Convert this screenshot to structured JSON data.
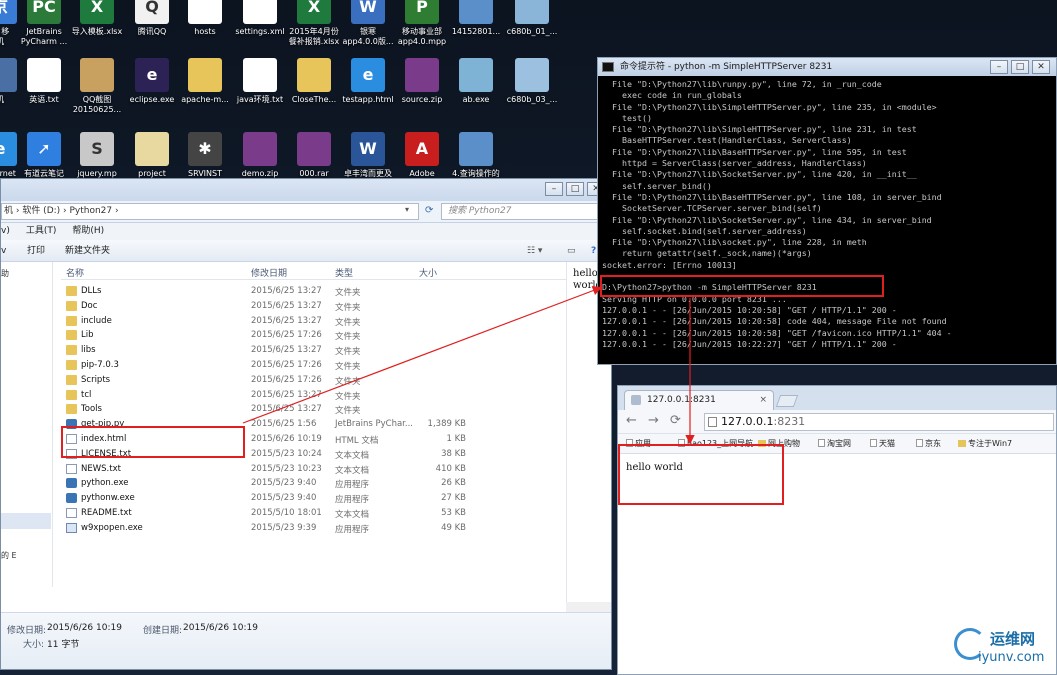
{
  "desktop": {
    "icons": [
      {
        "label": "京 移\n机",
        "icon": "app-icon",
        "color": "#3a7bd5",
        "glyph": "京"
      },
      {
        "label": "JetBrains\nPyCharm ...",
        "icon": "pycharm-icon",
        "color": "#2b7a3a",
        "glyph": "PC"
      },
      {
        "label": "导入模板.xlsx",
        "icon": "excel-icon",
        "color": "#1f7a3e",
        "glyph": "X"
      },
      {
        "label": "腾讯QQ",
        "icon": "qq-icon",
        "color": "#f1f1f1",
        "glyph": "Q"
      },
      {
        "label": "hosts",
        "icon": "file-icon",
        "color": "#ffffff",
        "glyph": ""
      },
      {
        "label": "settings.xml",
        "icon": "file-icon",
        "color": "#ffffff",
        "glyph": ""
      },
      {
        "label": "2015年4月份\n餐补报销.xlsx",
        "icon": "excel-icon",
        "color": "#1f7a3e",
        "glyph": "X"
      },
      {
        "label": "银寒\napp4.0.0版...",
        "icon": "document-icon",
        "color": "#3a6fbf",
        "glyph": "W"
      },
      {
        "label": "移动事业部\napp4.0.mpp",
        "icon": "project-icon",
        "color": "#2e7d32",
        "glyph": "P"
      },
      {
        "label": "14152801...",
        "icon": "image-icon",
        "color": "#5a8fc9",
        "glyph": ""
      },
      {
        "label": "c680b_01_...",
        "icon": "image-icon",
        "color": "#8ab4d8",
        "glyph": ""
      },
      {
        "label": "机",
        "icon": "app-icon",
        "color": "#4a6fa5",
        "glyph": ""
      },
      {
        "label": "英语.txt",
        "icon": "text-file-icon",
        "color": "#ffffff",
        "glyph": ""
      },
      {
        "label": "QQ截图\n20150625...",
        "icon": "image-icon",
        "color": "#c8a060",
        "glyph": ""
      },
      {
        "label": "eclipse.exe",
        "icon": "eclipse-icon",
        "color": "#2c2255",
        "glyph": "e"
      },
      {
        "label": "apache-m...",
        "icon": "folder-icon",
        "color": "#e8c55a",
        "glyph": ""
      },
      {
        "label": "java环境.txt",
        "icon": "text-file-icon",
        "color": "#ffffff",
        "glyph": ""
      },
      {
        "label": "CloseThe...",
        "icon": "folder-icon",
        "color": "#e8c55a",
        "glyph": ""
      },
      {
        "label": "testapp.html",
        "icon": "ie-icon",
        "color": "#2a8de0",
        "glyph": "e"
      },
      {
        "label": "source.zip",
        "icon": "zip-icon",
        "color": "#7a3b8a",
        "glyph": ""
      },
      {
        "label": "ab.exe",
        "icon": "exe-icon",
        "color": "#7fb3d6",
        "glyph": ""
      },
      {
        "label": "c680b_03_...",
        "icon": "image-icon",
        "color": "#9cc0e0",
        "glyph": ""
      },
      {
        "label": "Internet",
        "icon": "ie-icon",
        "color": "#2a8de0",
        "glyph": "e"
      },
      {
        "label": "有道云笔记",
        "icon": "youdao-icon",
        "color": "#2f7fe0",
        "glyph": "➚"
      },
      {
        "label": "jquery.mp",
        "icon": "script-icon",
        "color": "#c8c8c8",
        "glyph": "S"
      },
      {
        "label": "project",
        "icon": "document-icon",
        "color": "#e8d9a0",
        "glyph": ""
      },
      {
        "label": "SRVINST",
        "icon": "gear-icon",
        "color": "#444444",
        "glyph": "✱"
      },
      {
        "label": "demo.zip",
        "icon": "zip-icon",
        "color": "#7a3b8a",
        "glyph": ""
      },
      {
        "label": "000.rar",
        "icon": "zip-icon",
        "color": "#7a3b8a",
        "glyph": ""
      },
      {
        "label": "卓丰湾而更及",
        "icon": "word-icon",
        "color": "#2a5699",
        "glyph": "W"
      },
      {
        "label": "Adobe",
        "icon": "pdf-icon",
        "color": "#c81e1e",
        "glyph": "A"
      },
      {
        "label": "4.查询操作的",
        "icon": "window-icon",
        "color": "#5a8fc9",
        "glyph": ""
      }
    ]
  },
  "explorer": {
    "breadcrumb": "机 › 软件 (D:) › Python27 ›",
    "search_placeholder": "搜索 Python27",
    "menu": {
      "tools": "工具(T)",
      "help": "帮助(H)",
      "partial": "v)"
    },
    "toolbar": {
      "print": "打印",
      "new_folder": "新建文件夹",
      "partial": "v"
    },
    "columns": {
      "name": "名称",
      "date": "修改日期",
      "type": "类型",
      "size": "大小"
    },
    "files": [
      {
        "name": "DLLs",
        "date": "2015/6/25 13:27",
        "type": "文件夹",
        "size": "",
        "kind": "folder"
      },
      {
        "name": "Doc",
        "date": "2015/6/25 13:27",
        "type": "文件夹",
        "size": "",
        "kind": "folder"
      },
      {
        "name": "include",
        "date": "2015/6/25 13:27",
        "type": "文件夹",
        "size": "",
        "kind": "folder"
      },
      {
        "name": "Lib",
        "date": "2015/6/25 17:26",
        "type": "文件夹",
        "size": "",
        "kind": "folder"
      },
      {
        "name": "libs",
        "date": "2015/6/25 13:27",
        "type": "文件夹",
        "size": "",
        "kind": "folder"
      },
      {
        "name": "pip-7.0.3",
        "date": "2015/6/25 17:26",
        "type": "文件夹",
        "size": "",
        "kind": "folder"
      },
      {
        "name": "Scripts",
        "date": "2015/6/25 17:26",
        "type": "文件夹",
        "size": "",
        "kind": "folder"
      },
      {
        "name": "tcl",
        "date": "2015/6/25 13:27",
        "type": "文件夹",
        "size": "",
        "kind": "folder"
      },
      {
        "name": "Tools",
        "date": "2015/6/25 13:27",
        "type": "文件夹",
        "size": "",
        "kind": "folder"
      },
      {
        "name": "get-pip.py",
        "date": "2015/6/25 1:56",
        "type": "JetBrains PyChar...",
        "size": "1,389 KB",
        "kind": "py"
      },
      {
        "name": "index.html",
        "date": "2015/6/26 10:19",
        "type": "HTML 文档",
        "size": "1 KB",
        "kind": "doc"
      },
      {
        "name": "LICENSE.txt",
        "date": "2015/5/23 10:24",
        "type": "文本文档",
        "size": "38 KB",
        "kind": "doc"
      },
      {
        "name": "NEWS.txt",
        "date": "2015/5/23 10:23",
        "type": "文本文档",
        "size": "410 KB",
        "kind": "doc"
      },
      {
        "name": "python.exe",
        "date": "2015/5/23 9:40",
        "type": "应用程序",
        "size": "26 KB",
        "kind": "py"
      },
      {
        "name": "pythonw.exe",
        "date": "2015/5/23 9:40",
        "type": "应用程序",
        "size": "27 KB",
        "kind": "py"
      },
      {
        "name": "README.txt",
        "date": "2015/5/10 18:01",
        "type": "文本文档",
        "size": "53 KB",
        "kind": "doc"
      },
      {
        "name": "w9xpopen.exe",
        "date": "2015/5/23 9:39",
        "type": "应用程序",
        "size": "49 KB",
        "kind": "exe"
      }
    ],
    "preview_text": "hello\nworld",
    "nav_partial": [
      "助",
      "的 E"
    ],
    "details": {
      "modified_label": "修改日期:",
      "modified_value": "2015/6/26 10:19",
      "created_label": "创建日期:",
      "created_value": "2015/6/26 10:19",
      "size_label": "大小:",
      "size_value": "11 字节"
    }
  },
  "cmd": {
    "title": "命令提示符 - python  -m SimpleHTTPServer 8231",
    "lines": [
      "  File \"D:\\Python27\\lib\\runpy.py\", line 72, in _run_code",
      "    exec code in run_globals",
      "  File \"D:\\Python27\\lib\\SimpleHTTPServer.py\", line 235, in <module>",
      "    test()",
      "  File \"D:\\Python27\\lib\\SimpleHTTPServer.py\", line 231, in test",
      "    BaseHTTPServer.test(HandlerClass, ServerClass)",
      "  File \"D:\\Python27\\lib\\BaseHTTPServer.py\", line 595, in test",
      "    httpd = ServerClass(server_address, HandlerClass)",
      "  File \"D:\\Python27\\lib\\SocketServer.py\", line 420, in __init__",
      "    self.server_bind()",
      "  File \"D:\\Python27\\lib\\BaseHTTPServer.py\", line 108, in server_bind",
      "    SocketServer.TCPServer.server_bind(self)",
      "  File \"D:\\Python27\\lib\\SocketServer.py\", line 434, in server_bind",
      "    self.socket.bind(self.server_address)",
      "  File \"D:\\Python27\\lib\\socket.py\", line 228, in meth",
      "    return getattr(self._sock,name)(*args)",
      "socket.error: [Errno 10013]",
      "",
      "D:\\Python27>python -m SimpleHTTPServer 8231",
      "Serving HTTP on 0.0.0.0 port 8231 ...",
      "127.0.0.1 - - [26/Jun/2015 10:20:58] \"GET / HTTP/1.1\" 200 -",
      "127.0.0.1 - - [26/Jun/2015 10:20:58] code 404, message File not found",
      "127.0.0.1 - - [26/Jun/2015 10:20:58] \"GET /favicon.ico HTTP/1.1\" 404 -",
      "127.0.0.1 - - [26/Jun/2015 10:22:27] \"GET / HTTP/1.1\" 200 -"
    ]
  },
  "browser": {
    "tab_title": "127.0.0.1:8231",
    "url_host": "127.0.0.1",
    "url_port": ":8231",
    "bookmarks": [
      "应用",
      "hao123_上网导航",
      "网上购物",
      "淘宝网",
      "天猫",
      "京东",
      "专注于Win7"
    ],
    "page_text": "hello world"
  },
  "watermark": {
    "line1": "运维网",
    "line2": "iyunv.com"
  },
  "colors": {
    "annotation_red": "#e02020",
    "console_bg": "#000000",
    "console_text": "#c8c8c8"
  }
}
